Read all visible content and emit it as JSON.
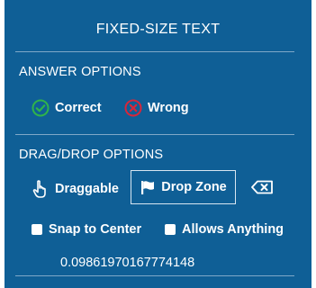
{
  "panel": {
    "title": "FIXED-SIZE TEXT"
  },
  "answer_options": {
    "label": "ANSWER OPTIONS",
    "correct_label": "Correct",
    "wrong_label": "Wrong",
    "correct_color": "#2fb34a",
    "wrong_color": "#d6273b"
  },
  "drag_drop_options": {
    "label": "DRAG/DROP OPTIONS",
    "draggable_label": "Draggable",
    "drop_zone_label": "Drop Zone",
    "drop_zone_selected": true,
    "snap_to_center_label": "Snap to Center",
    "snap_to_center_checked": false,
    "allows_anything_label": "Allows Anything",
    "allows_anything_checked": false
  },
  "value_readout": "0.09861970167774148",
  "icons": {
    "correct": "check-circle-icon",
    "wrong": "x-circle-icon",
    "draggable": "hand-pointer-icon",
    "drop_zone": "flag-icon",
    "clear": "backspace-icon"
  }
}
